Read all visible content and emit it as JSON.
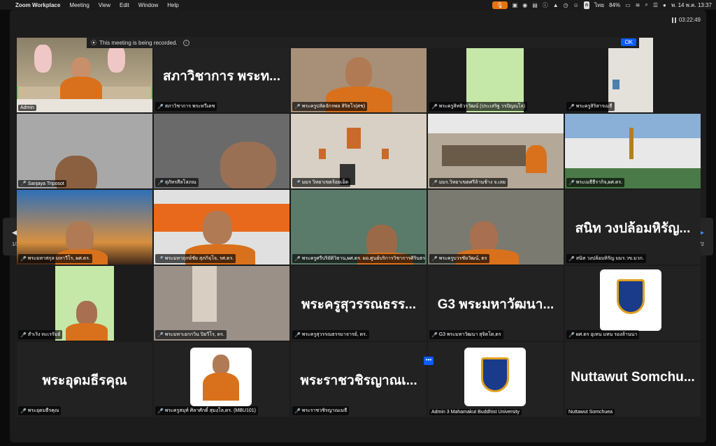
{
  "menubar": {
    "app_name": "Zoom Workplace",
    "items": [
      "Meeting",
      "View",
      "Edit",
      "Window",
      "Help"
    ],
    "lang_label": "ก",
    "lang_text": "ไทย",
    "battery": "84%",
    "datetime": "พ. 14 พ.ค.  13:37"
  },
  "meeting": {
    "timer": "03:22:49",
    "recording_notice": "This meeting is being recorded.",
    "ok_label": "OK",
    "page_left": "1/2",
    "page_right": "1/2"
  },
  "tiles": [
    {
      "name": "Admin"
    },
    {
      "name": "สภาวิชาการ พระทวีเดช",
      "big": "สภาวิชาการ พระท..."
    },
    {
      "name": "พระครูปลัดจักรพล สิริธโร(ศช)"
    },
    {
      "name": "พระครูสิทธิวรวัฒน์ (ประเสริฐ วรปัญญฺโล)"
    },
    {
      "name": "พระครูสิริสารเมธี"
    },
    {
      "name": "Sanjaya Triposot"
    },
    {
      "name": "สุภัทรสีลโสภณ"
    },
    {
      "name": "มมร วิทยาเขตร้อยเอ็ด"
    },
    {
      "name": "มมร.วิทยาเขตศรีล้านช้าง จ.เลย"
    },
    {
      "name": "พระเมธีธีรากิจ,ผศ.ดร."
    },
    {
      "name": "พระมหาสกุล มหาวีโร, ผศ.ดร."
    },
    {
      "name": "พระมหาฤกษ์ชัย สุภกิจฺโจ, รศ.ดร."
    },
    {
      "name": "พระครูศรีปริยัติวิธาน,ผศ.ดร. ผอ.ศูนย์บริการวิชาการศิรินธร"
    },
    {
      "name": "พระครูบวรชัยวัฒน์, ดร"
    },
    {
      "name": "สนิท  วงปล้อมหิรัญ มมร.วข.มวก.",
      "big": "สนิท  วงปล้อมหิรัญ..."
    },
    {
      "name": "สำเริง ทะเรรัมย์"
    },
    {
      "name": "พระมหาเอกกวิน ปิยวีโร, ดร."
    },
    {
      "name": "พระครูสุวรรณธรรมาจารย์, ดร.",
      "big": "พระครูสุวรรณธรร..."
    },
    {
      "name": "G3 พระมหาวัฒนา สุจิตโต,ดร",
      "big": "G3 พระมหาวัฒนา..."
    },
    {
      "name": "ผศ.ดร อุเทน แทน รองล้านนา"
    },
    {
      "name": "พระอุดมธีรคุณ",
      "big": "พระอุดมธีรคุณ"
    },
    {
      "name": "พระครูสมุห์ ศิลาศักดิ์ สุมงฺโล,ดร. (MBU101)"
    },
    {
      "name": "พระราชวชิรญาณเมธี",
      "big": "พระราชวชิรญาณเ..."
    },
    {
      "name": "Admin 3 Mahamakut Buddhist University"
    },
    {
      "name": "Nuttawut Somchuea",
      "big": "Nuttawut Somchu..."
    }
  ],
  "colors": {
    "accent": "#0b5cff",
    "active_speaker": "#5fd35f",
    "mute": "#e33333",
    "robe": "#d9711c"
  }
}
